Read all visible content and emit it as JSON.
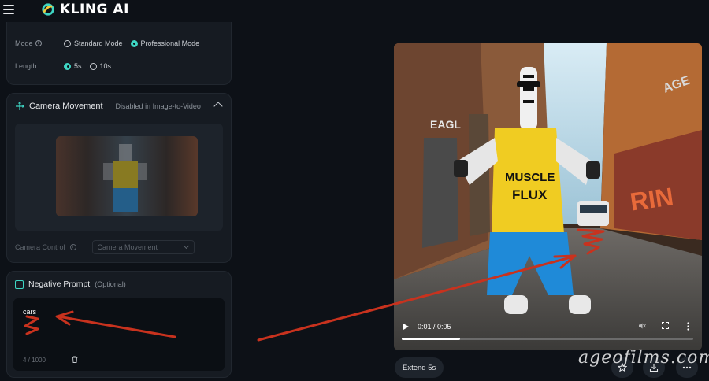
{
  "app": {
    "brand": "KLING AI"
  },
  "settings": {
    "mode_label": "Mode",
    "mode_options": [
      "Standard Mode",
      "Professional Mode"
    ],
    "mode_selected": "Professional Mode",
    "length_label": "Length:",
    "length_options": [
      "5s",
      "10s"
    ],
    "length_selected": "5s"
  },
  "camera": {
    "title": "Camera Movement",
    "note": "Disabled in Image-to-Video",
    "control_label": "Camera Control",
    "control_value": "Camera Movement"
  },
  "negative_prompt": {
    "title": "Negative Prompt",
    "optional": "(Optional)",
    "value": "cars",
    "count": "4 / 1000"
  },
  "player": {
    "time": "0:01 / 0:05",
    "progress": 0.2,
    "shirt_text_1": "MUSCLE",
    "shirt_text_2": "FLUX",
    "sign_1": "EAGL",
    "sign_2": "AGE",
    "graffiti": "RIN"
  },
  "actions": {
    "extend_label": "Extend 5s"
  },
  "watermark": "ageofilms.com",
  "colors": {
    "accent": "#3ed6c4",
    "annotation": "#c8321e"
  }
}
